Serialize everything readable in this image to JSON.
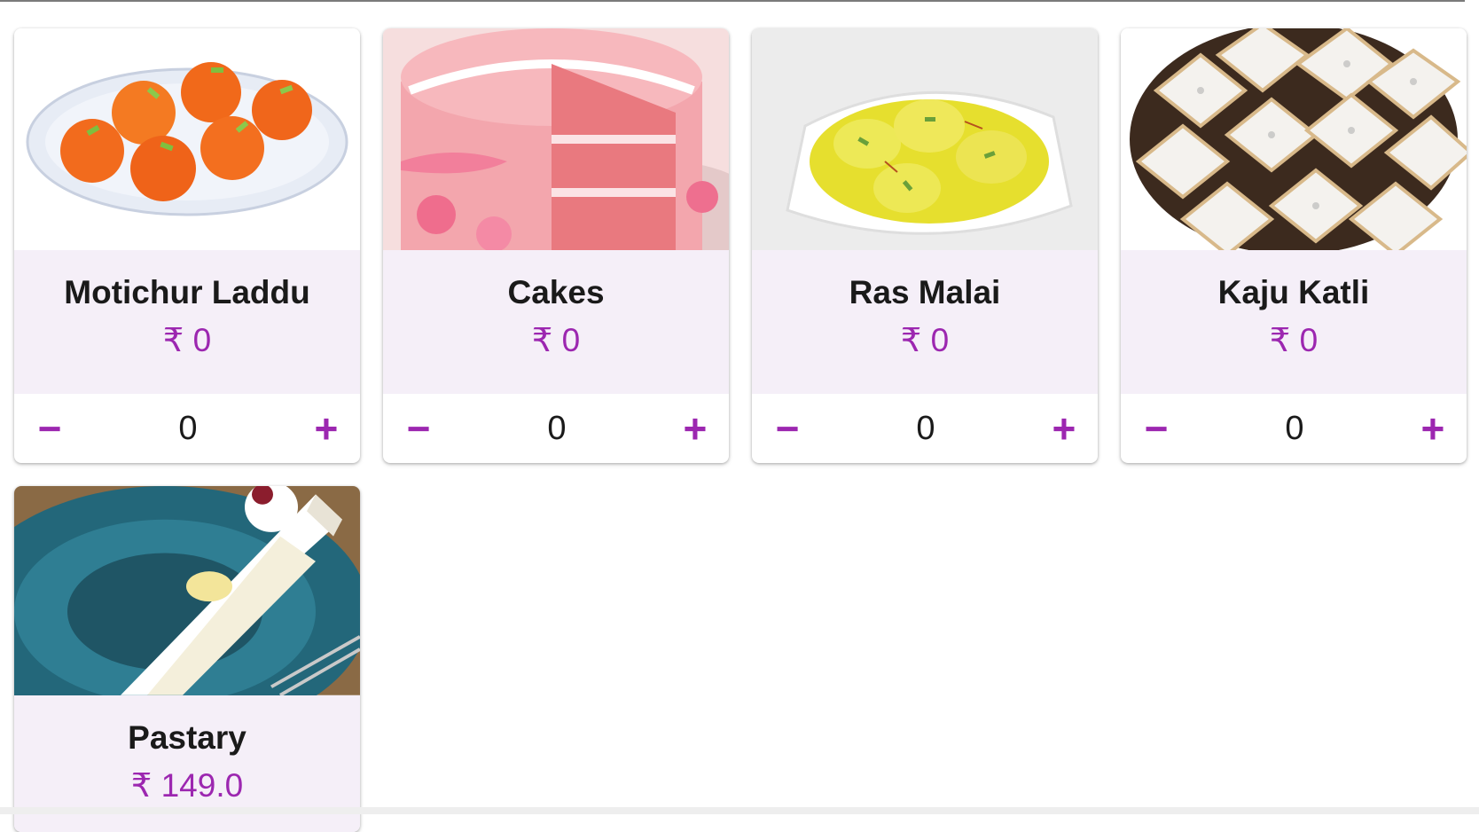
{
  "products": [
    {
      "name": "Motichur Laddu",
      "price": "₹ 0",
      "qty": "0",
      "image_icon": "laddu-image"
    },
    {
      "name": "Cakes",
      "price": "₹ 0",
      "qty": "0",
      "image_icon": "cake-image"
    },
    {
      "name": "Ras Malai",
      "price": "₹ 0",
      "qty": "0",
      "image_icon": "rasmalai-image"
    },
    {
      "name": "Kaju Katli",
      "price": "₹ 0",
      "qty": "0",
      "image_icon": "kajukatli-image"
    },
    {
      "name": "Pastary",
      "price": "₹ 149.0",
      "qty": "",
      "image_icon": "pastry-image"
    }
  ],
  "controls": {
    "minus": "−",
    "plus": "+"
  },
  "colors": {
    "accent": "#9c27b0",
    "info_bg": "#f5eff8"
  }
}
